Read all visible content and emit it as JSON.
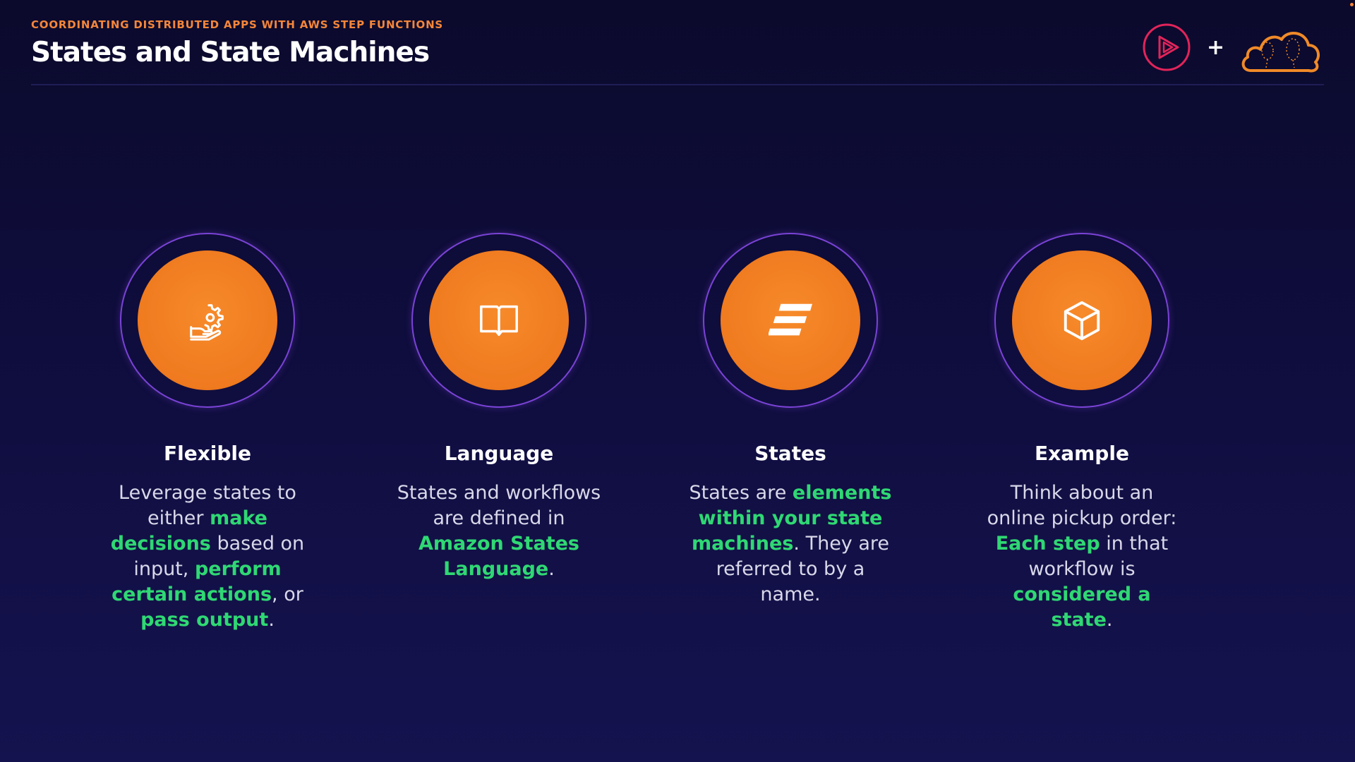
{
  "header": {
    "eyebrow": "COORDINATING DISTRIBUTED APPS WITH AWS STEP FUNCTIONS",
    "title": "States and State Machines"
  },
  "logos": {
    "play_icon": "pluralsight-play-icon",
    "plus": "+",
    "cloud_icon": "cloud-guru-cloud-icon"
  },
  "colors": {
    "accent_orange": "#ef7a1f",
    "highlight_green": "#2fd873",
    "ring_purple": "#7a43d6",
    "background": "#0f0d3d"
  },
  "cards": [
    {
      "icon": "gear-hand-icon",
      "title": "Flexible",
      "text": [
        {
          "t": "Leverage states to either ",
          "hl": false
        },
        {
          "t": "make decisions",
          "hl": true
        },
        {
          "t": " based on input, ",
          "hl": false
        },
        {
          "t": "perform certain actions",
          "hl": true
        },
        {
          "t": ", or ",
          "hl": false
        },
        {
          "t": "pass output",
          "hl": true
        },
        {
          "t": ".",
          "hl": false
        }
      ]
    },
    {
      "icon": "book-icon",
      "title": "Language",
      "text": [
        {
          "t": "States and workflows are defined in ",
          "hl": false
        },
        {
          "t": "Amazon States Language",
          "hl": true
        },
        {
          "t": ".",
          "hl": false
        }
      ]
    },
    {
      "icon": "step-bars-icon",
      "title": "States",
      "text": [
        {
          "t": "States are ",
          "hl": false
        },
        {
          "t": "elements within your state machines",
          "hl": true
        },
        {
          "t": ". They are referred to by a name.",
          "hl": false
        }
      ]
    },
    {
      "icon": "cube-icon",
      "title": "Example",
      "text": [
        {
          "t": "Think about an online pickup order: ",
          "hl": false
        },
        {
          "t": "Each step",
          "hl": true
        },
        {
          "t": " in that workflow is ",
          "hl": false
        },
        {
          "t": "considered a state",
          "hl": true
        },
        {
          "t": ".",
          "hl": false
        }
      ]
    }
  ]
}
